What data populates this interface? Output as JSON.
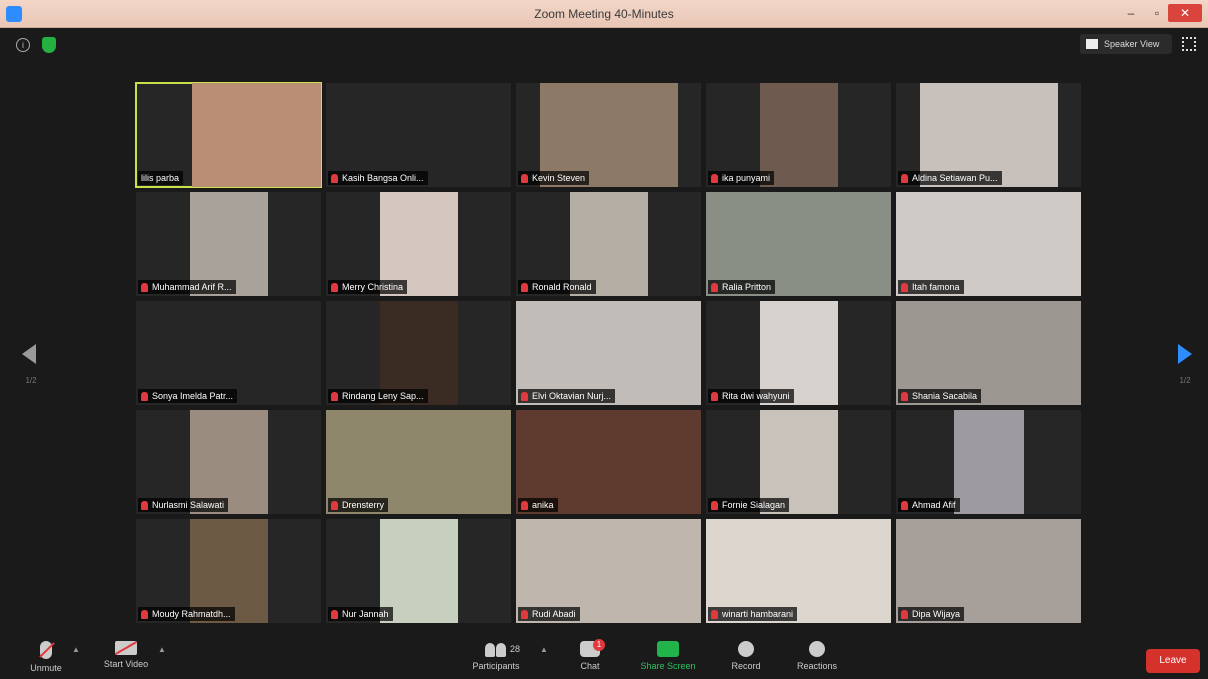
{
  "window": {
    "title": "Zoom Meeting 40-Minutes",
    "min": "–",
    "max": "▫",
    "close": "✕"
  },
  "header": {
    "info": "i",
    "view_label": "Speaker View"
  },
  "pagination": {
    "prev_page": "1/2",
    "next_page": "1/2"
  },
  "participants": [
    {
      "name": "lilis parba",
      "muted": false,
      "active": true
    },
    {
      "name": "Kasih Bangsa Onli...",
      "muted": true
    },
    {
      "name": "Kevin Steven",
      "muted": true
    },
    {
      "name": "ika punyami",
      "muted": true
    },
    {
      "name": "Aldina Setiawan Pu...",
      "muted": true
    },
    {
      "name": "Muhammad Arif R...",
      "muted": true
    },
    {
      "name": "Merry Christina",
      "muted": true
    },
    {
      "name": "Ronald Ronald",
      "muted": true
    },
    {
      "name": "Ralia Pritton",
      "muted": true
    },
    {
      "name": "Itah famona",
      "muted": true
    },
    {
      "name": "Sonya Imelda Patr...",
      "muted": true
    },
    {
      "name": "Rindang Leny Sap...",
      "muted": true
    },
    {
      "name": "Elvi Oktavian Nurj...",
      "muted": true
    },
    {
      "name": "Rita dwi wahyuni",
      "muted": true
    },
    {
      "name": "Shania Sacabila",
      "muted": true
    },
    {
      "name": "Nurlasmi Salawati",
      "muted": true
    },
    {
      "name": "Drensterry",
      "muted": true
    },
    {
      "name": "anika",
      "muted": true
    },
    {
      "name": "Fornie Sialagan",
      "muted": true
    },
    {
      "name": "Ahmad Afif",
      "muted": true
    },
    {
      "name": "Moudy Rahmatdh...",
      "muted": true
    },
    {
      "name": "Nur Jannah",
      "muted": true
    },
    {
      "name": "Rudi Abadi",
      "muted": true
    },
    {
      "name": "winarti hambarani",
      "muted": true
    },
    {
      "name": "Dipa Wijaya",
      "muted": true
    }
  ],
  "toolbar": {
    "unmute": "Unmute",
    "start_video": "Start Video",
    "participants": "Participants",
    "participants_count": "28",
    "chat": "Chat",
    "chat_badge": "1",
    "share_screen": "Share Screen",
    "record": "Record",
    "reactions": "Reactions",
    "leave": "Leave"
  },
  "colors": {
    "accent": "#2d8cff",
    "active_speaker": "#c9e04a",
    "leave": "#d5322b",
    "share": "#20b44b",
    "muted": "#e0393e"
  }
}
